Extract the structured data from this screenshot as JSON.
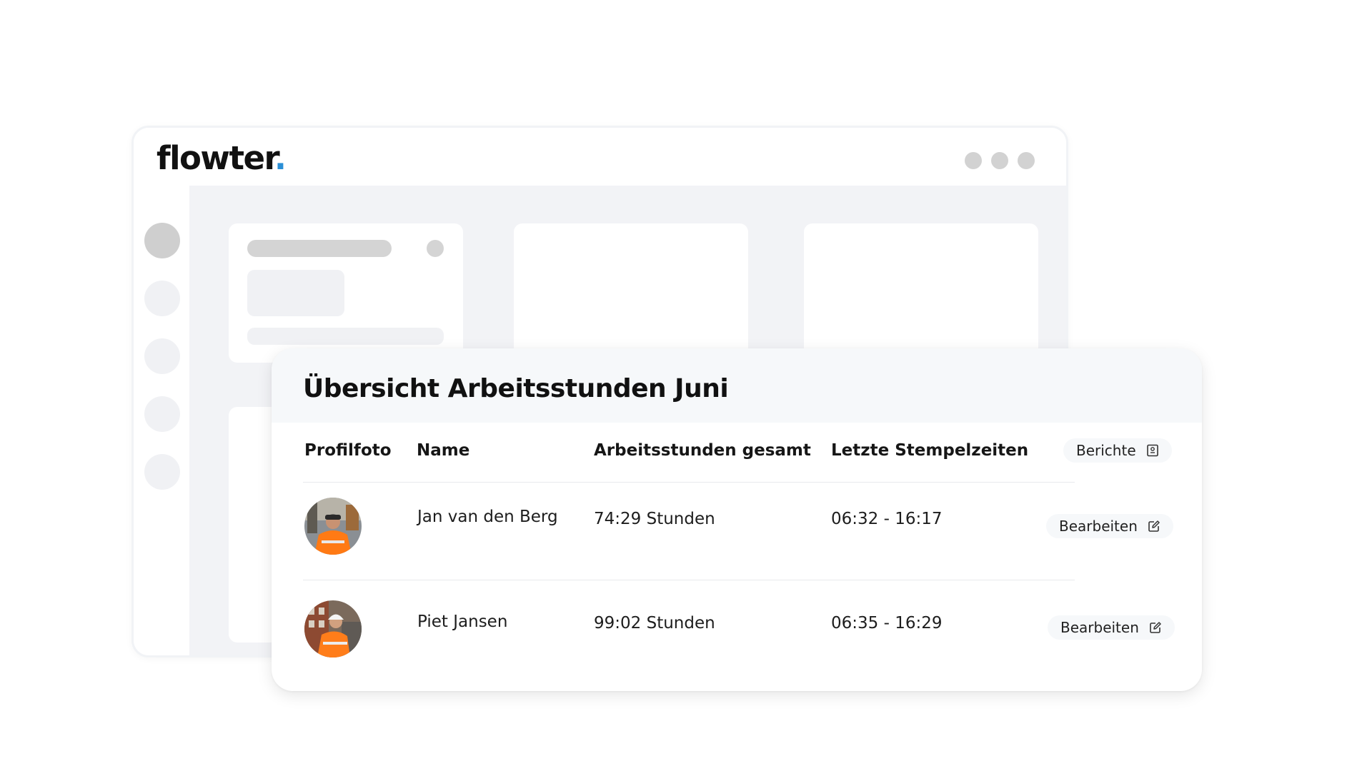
{
  "app": {
    "logo_text": "flowter",
    "logo_dot": ".",
    "accent_color": "#2b8fd6"
  },
  "card": {
    "title": "Übersicht Arbeitsstunden Juni",
    "columns": [
      "Profilfoto",
      "Name",
      "Arbeitsstunden gesamt",
      "Letzte Stempelzeiten"
    ],
    "reports_button": {
      "label": "Berichte",
      "icon": "report-icon"
    },
    "rows": [
      {
        "avatar": "worker-photo-jan",
        "name": "Jan van den Berg",
        "hours": "74:29 Stunden",
        "times": "06:32 - 16:17",
        "action": "Bearbeiten",
        "action_icon": "edit-icon"
      },
      {
        "avatar": "worker-photo-piet",
        "name": "Piet Jansen",
        "hours": "99:02 Stunden",
        "times": "06:35 - 16:29",
        "action": "Bearbeiten",
        "action_icon": "edit-icon"
      }
    ]
  }
}
